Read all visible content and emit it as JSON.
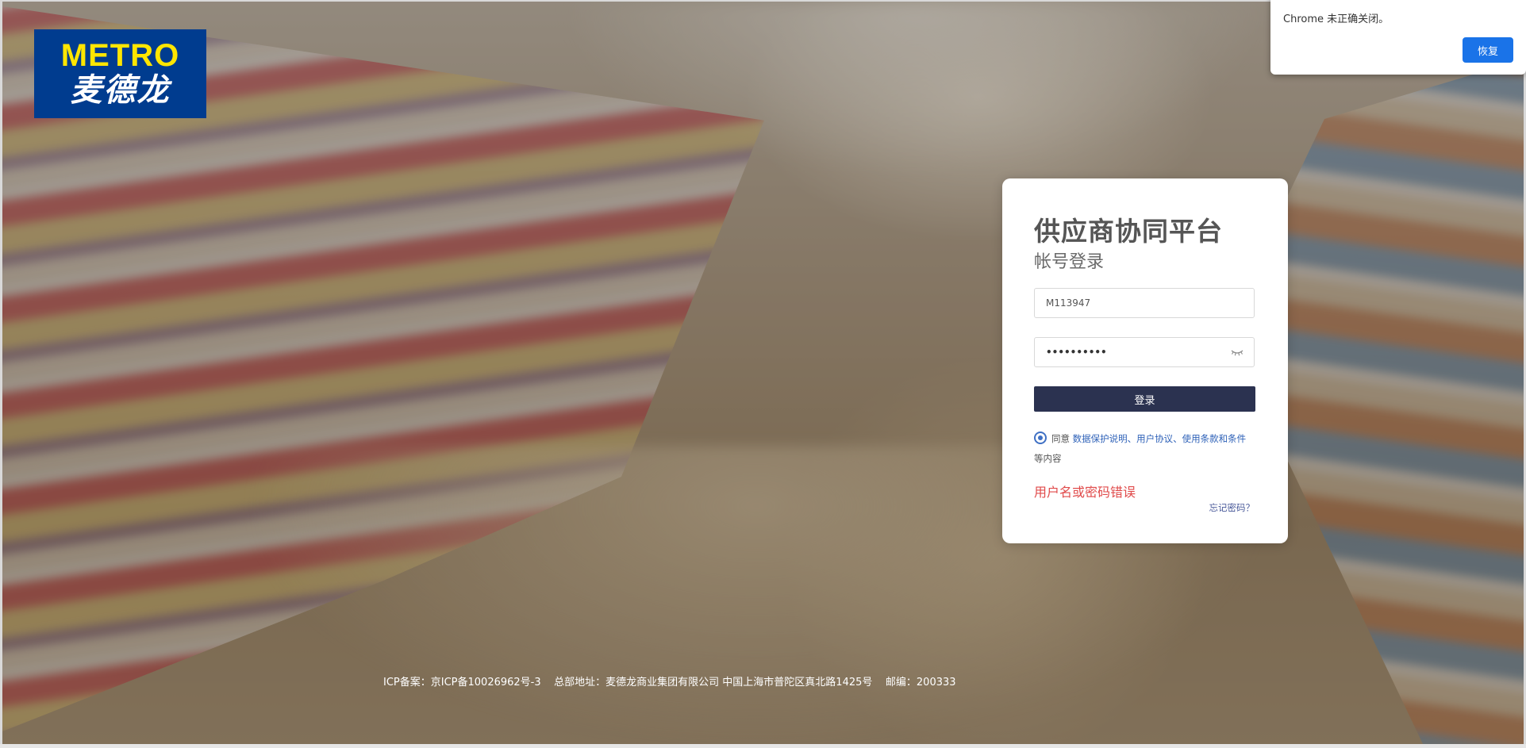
{
  "logo": {
    "brand": "METRO",
    "name_cn": "麦德龙"
  },
  "restore_popup": {
    "message": "Chrome 未正确关闭。",
    "button_label": "恢复"
  },
  "login": {
    "title": "供应商协同平台",
    "subtitle": "帐号登录",
    "username_value": "M113947",
    "password_mask": "••••••••••",
    "submit_label": "登录",
    "agree_prefix": "同意 ",
    "agree_links": "数据保护说明、用户协议、使用条款和条件",
    "agree_suffix": "等内容",
    "error_message": "用户名或密码错误",
    "forgot_password": "忘记密码？"
  },
  "footer": {
    "text": "ICP备案：京ICP备10026962号-3    总部地址：麦德龙商业集团有限公司 中国上海市普陀区真北路1425号    邮编：200333"
  },
  "colors": {
    "logo_bg": "#003c8f",
    "logo_brand": "#ffe600",
    "login_button": "#2b3250",
    "error_text": "#e04a4a",
    "link_text": "#2f62b8",
    "restore_button": "#1a73e8"
  },
  "icons": {
    "password_toggle": "eye-closed-icon",
    "agree_radio": "radio-checked-icon"
  }
}
